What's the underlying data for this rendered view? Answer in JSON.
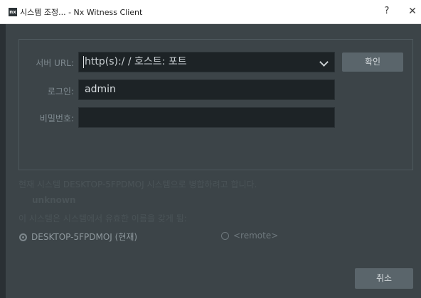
{
  "window": {
    "title": "시스템 조정... - Nx Witness Client",
    "app_icon_text": "nx",
    "help_label": "?",
    "close_label": "✕"
  },
  "form": {
    "server_url_label": "서버 URL:",
    "server_url_placeholder": "http(s):/ / 호스트: 포트",
    "confirm_label": "확인",
    "login_label": "로그인:",
    "login_value": "admin",
    "password_label": "비밀번호:",
    "password_value": ""
  },
  "status": {
    "merge_message": "현재 시스템 DESKTOP-5FPDMOJ 시스템으로 병합하려고 합니다.",
    "unknown_text": "unknown",
    "question_text": "이 시스템은 시스템에서 유효한 이름을 갖게 됨:"
  },
  "options": {
    "current": "DESKTOP-5FPDMOJ (현재)",
    "remote": "<remote>"
  },
  "footer": {
    "cancel_label": "취소"
  },
  "colors": {
    "background": "#3c4448",
    "field_bg": "#1d2326",
    "button_bg": "#5a656b",
    "label_color": "#7f8a90"
  }
}
